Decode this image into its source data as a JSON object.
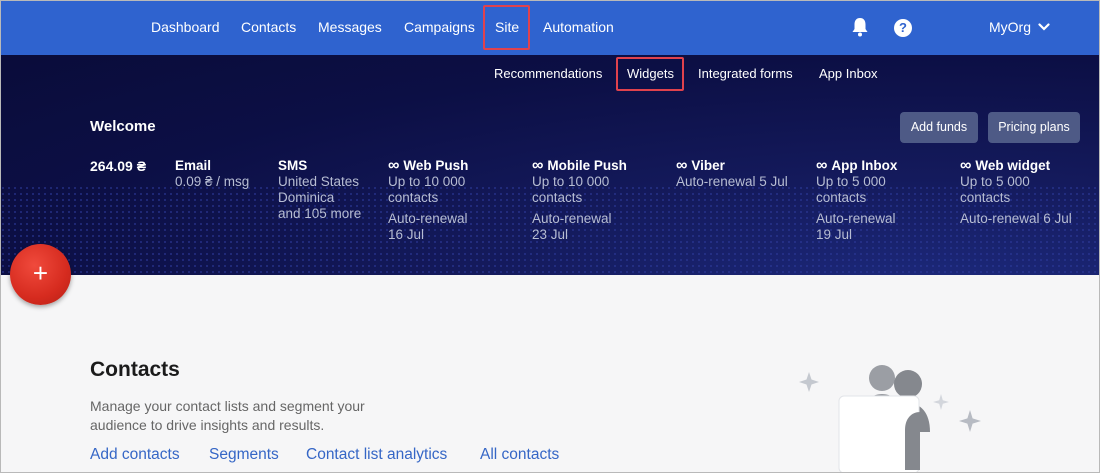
{
  "topnav": {
    "items": [
      {
        "label": "Dashboard"
      },
      {
        "label": "Contacts"
      },
      {
        "label": "Messages"
      },
      {
        "label": "Campaigns"
      },
      {
        "label": "Site"
      },
      {
        "label": "Automation"
      }
    ],
    "help_symbol": "?",
    "org": "MyOrg",
    "icons": [
      "bell-icon",
      "help-icon",
      "chevron-down-icon"
    ]
  },
  "subnav": {
    "items": [
      {
        "label": "Recommendations"
      },
      {
        "label": "Widgets"
      },
      {
        "label": "Integrated forms"
      },
      {
        "label": "App Inbox"
      }
    ]
  },
  "banner": {
    "welcome": "Welcome",
    "add_funds": "Add funds",
    "pricing_plans": "Pricing plans",
    "balance": "264.09 ₴",
    "services": [
      {
        "name": "Email",
        "lines": [
          "0.09 ₴ / msg"
        ]
      },
      {
        "name": "SMS",
        "lines": [
          "United States",
          "Dominica",
          "and 105 more"
        ]
      },
      {
        "name": "Web Push",
        "unlimited": true,
        "lines": [
          "Up to 10 000",
          "contacts"
        ],
        "renewal": [
          "Auto-renewal",
          "16 Jul"
        ]
      },
      {
        "name": "Mobile Push",
        "unlimited": true,
        "lines": [
          "Up to 10 000",
          "contacts"
        ],
        "renewal": [
          "Auto-renewal",
          "23 Jul"
        ]
      },
      {
        "name": "Viber",
        "unlimited": true,
        "lines": [
          "Auto-renewal 5 Jul"
        ]
      },
      {
        "name": "App Inbox",
        "unlimited": true,
        "lines": [
          "Up to 5 000",
          "contacts"
        ],
        "renewal": [
          "Auto-renewal",
          "19 Jul"
        ]
      },
      {
        "name": "Web widget",
        "unlimited": true,
        "lines": [
          "Up to 5 000",
          "contacts"
        ],
        "renewal": [
          "Auto-renewal 6 Jul"
        ]
      }
    ],
    "infinity_symbol": "∞"
  },
  "fab": {
    "symbol": "+"
  },
  "contacts": {
    "title": "Contacts",
    "description": "Manage your contact lists and segment your audience to drive insights and results.",
    "links": [
      {
        "label": "Add contacts"
      },
      {
        "label": "Segments"
      },
      {
        "label": "Contact list analytics"
      },
      {
        "label": "All contacts"
      }
    ]
  },
  "colors": {
    "nav_bg": "#2f63cf",
    "banner_bg": "#0c0f45",
    "highlight": "#e0424d",
    "link": "#3566c6",
    "fab": "#d62b1f"
  }
}
